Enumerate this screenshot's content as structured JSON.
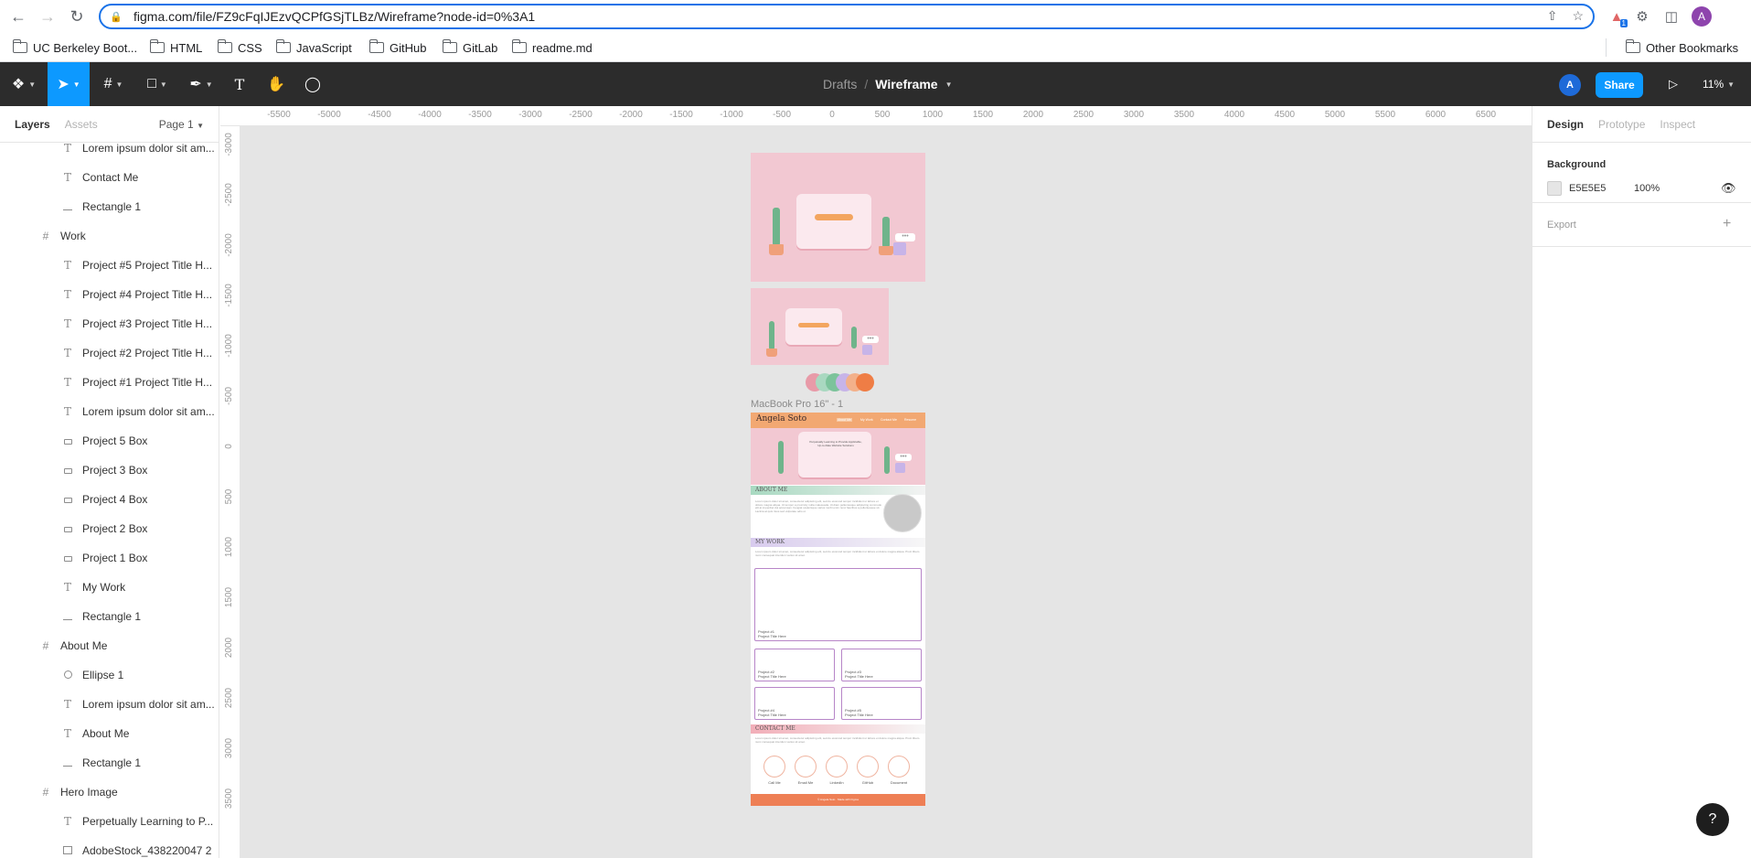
{
  "browser": {
    "url": "figma.com/file/FZ9cFqIJEzvQCPfGSjTLBz/Wireframe?node-id=0%3A1",
    "bookmarks": [
      "UC Berkeley Boot...",
      "HTML",
      "CSS",
      "JavaScript",
      "GitHub",
      "GitLab",
      "readme.md"
    ],
    "other_bookmarks": "Other Bookmarks",
    "profile_initial": "A",
    "extension_badge": "1"
  },
  "toolbar": {
    "breadcrumb_root": "Drafts",
    "breadcrumb_sep": "/",
    "file_name": "Wireframe",
    "avatar_initial": "A",
    "share_label": "Share",
    "zoom": "11%"
  },
  "left_panel": {
    "tabs": [
      "Layers",
      "Assets"
    ],
    "page": "Page 1",
    "layers": [
      {
        "name": "Lorem ipsum dolor sit am...",
        "icon": "text-icon"
      },
      {
        "name": "Contact Me",
        "icon": "text-icon"
      },
      {
        "name": "Rectangle 1",
        "icon": "line-icon"
      },
      {
        "name": "Work",
        "icon": "frame-icon"
      },
      {
        "name": "Project #5 Project Title H...",
        "icon": "text-icon"
      },
      {
        "name": "Project #4 Project Title H...",
        "icon": "text-icon"
      },
      {
        "name": "Project #3 Project Title H...",
        "icon": "text-icon"
      },
      {
        "name": "Project #2 Project Title H...",
        "icon": "text-icon"
      },
      {
        "name": "Project #1 Project Title H...",
        "icon": "text-icon"
      },
      {
        "name": "Lorem ipsum dolor sit am...",
        "icon": "text-icon"
      },
      {
        "name": "Project 5 Box",
        "icon": "rectangle-icon"
      },
      {
        "name": "Project 3 Box",
        "icon": "rectangle-icon"
      },
      {
        "name": "Project 4 Box",
        "icon": "rectangle-icon"
      },
      {
        "name": "Project 2 Box",
        "icon": "rectangle-icon"
      },
      {
        "name": "Project 1 Box",
        "icon": "rectangle-icon"
      },
      {
        "name": "My Work",
        "icon": "text-icon"
      },
      {
        "name": "Rectangle 1",
        "icon": "line-icon"
      },
      {
        "name": "About Me",
        "icon": "frame-icon"
      },
      {
        "name": "Ellipse 1",
        "icon": "ellipse-icon"
      },
      {
        "name": "Lorem ipsum dolor sit am...",
        "icon": "text-icon"
      },
      {
        "name": "About Me",
        "icon": "text-icon"
      },
      {
        "name": "Rectangle 1",
        "icon": "line-icon"
      },
      {
        "name": "Hero Image",
        "icon": "frame-icon"
      },
      {
        "name": "Perpetually Learning to P...",
        "icon": "text-icon"
      },
      {
        "name": "AdobeStock_438220047 2",
        "icon": "image-icon"
      }
    ]
  },
  "ruler": {
    "horizontal": [
      "-5500",
      "-5000",
      "-4500",
      "-4000",
      "-3500",
      "-3000",
      "-2500",
      "-2000",
      "-1500",
      "-1000",
      "-500",
      "0",
      "500",
      "1000",
      "1500",
      "2000",
      "2500",
      "3000",
      "3500",
      "4000",
      "4500",
      "5000",
      "5500",
      "6000",
      "6500"
    ],
    "vertical": [
      "-3000",
      "-2500",
      "-2000",
      "-1500",
      "-1000",
      "-500",
      "0",
      "500",
      "1000",
      "1500",
      "2000",
      "2500",
      "3000",
      "3500"
    ]
  },
  "canvas": {
    "frame_label": "MacBook Pro 16\" - 1",
    "site_logo": "Angela Soto",
    "site_nav": [
      "About Me",
      "My Work",
      "Contact Me",
      "Resume"
    ],
    "hero_text": "Perpetually Learning to Provide Applicable, Up-to-Date Website Solutions",
    "section_about": "ABOUT ME",
    "section_work": "MY WORK",
    "section_contact": "CONTACT ME",
    "lorem": "Lorem ipsum dolor sit amet, consectetur adipiscing elit, sed do eiusmod tempor incididunt ut labore et dolore magna aliqua. Ut tempor a proximity nulla malesuada. Ut diam pellentesque adipiscing commodo elit at imperdiet dui accumsan. Feugiat scelerisque varius morbi enim nunc faucibus a pellentesque sit. Lacinia at quis risus sed vulputate odio ut.",
    "lorem_short": "Lorem ipsum dolor sit amet, consectetur adipiscing elit, sed do eiusmod tempor incididunt ut labore et dolore magna aliqua. Proin libero nunc consequat interdum varius sit amet.",
    "projects": [
      {
        "num": "Project #1",
        "title": "Project Title Here"
      },
      {
        "num": "Project #2",
        "title": "Project Title Here"
      },
      {
        "num": "Project #3",
        "title": "Project Title Here"
      },
      {
        "num": "Project #4",
        "title": "Project Title Here"
      },
      {
        "num": "Project #5",
        "title": "Project Title Here"
      }
    ],
    "contacts": [
      "Call Me",
      "Email Me",
      "LinkedIn",
      "GitHub",
      "Document"
    ],
    "footer_text": "© Angela Soto · Made with Figma",
    "swatches": [
      "#e89aa8",
      "#a9d8c0",
      "#7cc39b",
      "#c7b4e8",
      "#f3b08a",
      "#ef7d45"
    ]
  },
  "right_panel": {
    "tabs": [
      "Design",
      "Prototype",
      "Inspect"
    ],
    "background_title": "Background",
    "bg_hex": "E5E5E5",
    "bg_opacity": "100%",
    "export_title": "Export"
  },
  "help_label": "?"
}
